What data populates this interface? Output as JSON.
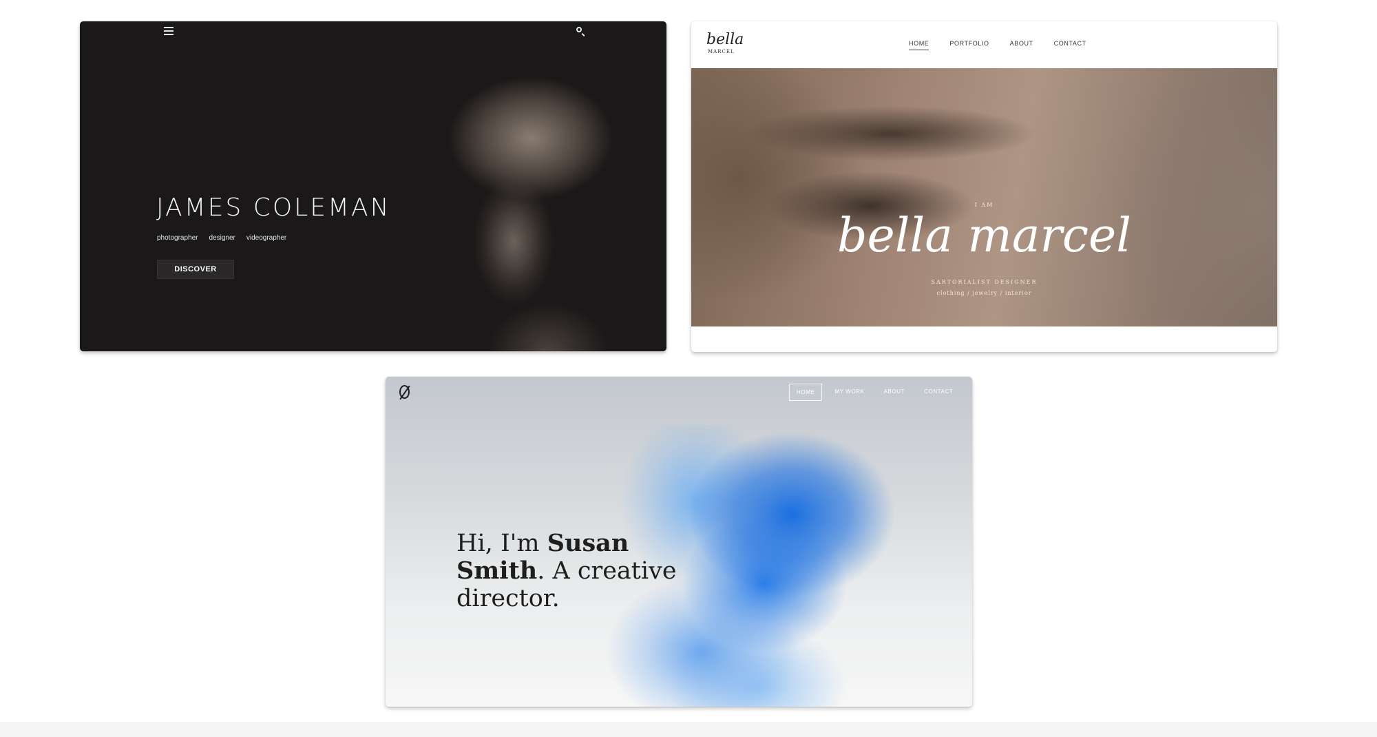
{
  "james_coleman": {
    "name": "JAMES COLEMAN",
    "roles": [
      "photographer",
      "designer",
      "videographer"
    ],
    "cta_label": "DISCOVER",
    "menu_icon": "hamburger-menu-icon",
    "search_icon": "search-icon"
  },
  "bella_marcel": {
    "logo_script": "bella",
    "logo_sub": "MARCEL",
    "nav": [
      "HOME",
      "PORTFOLIO",
      "ABOUT",
      "CONTACT"
    ],
    "active_nav": "HOME",
    "intro": "I AM",
    "title": "bella marcel",
    "subtitle": "SARTORIALIST DESIGNER",
    "tags": "clothing / jewelry / interior"
  },
  "susan_smith": {
    "logo_icon": "slashed-circle-logo-icon",
    "nav": [
      "HOME",
      "MY WORK",
      "ABOUT",
      "CONTACT"
    ],
    "active_nav": "HOME",
    "heading_prefix": "Hi, I'm ",
    "heading_name_1": "Susan",
    "heading_name_2": "Smith",
    "heading_suffix": ". A creative director."
  },
  "colors": {
    "dark_bg": "#1a1818",
    "bella_hero": "#a08474",
    "ink_blue": "#1b6fe0"
  }
}
